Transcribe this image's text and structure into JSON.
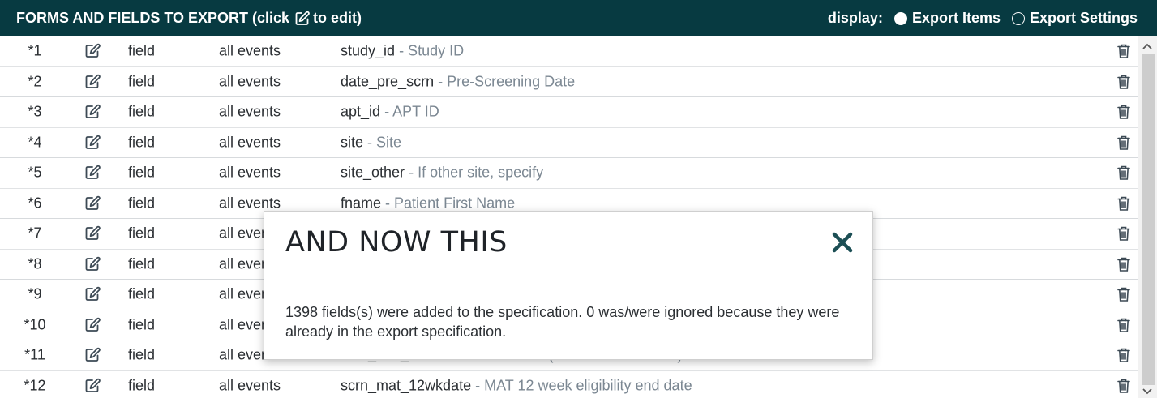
{
  "header": {
    "title_before": "FORMS AND FIELDS TO EXPORT (click",
    "title_after": "to edit)",
    "display_label": "display:",
    "options": [
      {
        "label": "Export Items",
        "selected": true
      },
      {
        "label": "Export Settings",
        "selected": false
      }
    ]
  },
  "rows": [
    {
      "num": "*1",
      "type": "field",
      "events": "all events",
      "name": "study_id",
      "label": "- Study ID"
    },
    {
      "num": "*2",
      "type": "field",
      "events": "all events",
      "name": "date_pre_scrn",
      "label": "- Pre-Screening Date"
    },
    {
      "num": "*3",
      "type": "field",
      "events": "all events",
      "name": "apt_id",
      "label": "- APT ID"
    },
    {
      "num": "*4",
      "type": "field",
      "events": "all events",
      "name": "site",
      "label": "- Site"
    },
    {
      "num": "*5",
      "type": "field",
      "events": "all events",
      "name": "site_other",
      "label": "- If other site, specify"
    },
    {
      "num": "*6",
      "type": "field",
      "events": "all events",
      "name": "fname",
      "label": "- Patient First Name"
    },
    {
      "num": "*7",
      "type": "field",
      "events": "all events",
      "name": "",
      "label": ""
    },
    {
      "num": "*8",
      "type": "field",
      "events": "all events",
      "name": "",
      "label": ""
    },
    {
      "num": "*9",
      "type": "field",
      "events": "all events",
      "name": "",
      "label": ""
    },
    {
      "num": "*10",
      "type": "field",
      "events": "all events",
      "name": "",
      "label": ""
    },
    {
      "num": "*11",
      "type": "field",
      "events": "all events",
      "name": "scrn_mat_start",
      "label": "- MAT start date (less than 24 weeks)"
    },
    {
      "num": "*12",
      "type": "field",
      "events": "all events",
      "name": "scrn_mat_12wkdate",
      "label": "- MAT 12 week eligibility end date"
    }
  ],
  "modal": {
    "title": "AND NOW THIS",
    "body": "1398 fields(s) were added to the specification. 0 was/were ignored because they were already in the export specification."
  },
  "colors": {
    "header_bg": "#073a41",
    "label_gray": "#7b8792",
    "text": "#2b2f33",
    "close_icon": "#1c4f55"
  },
  "icons": {
    "edit": "edit-icon",
    "delete": "trash-icon",
    "close": "close-icon"
  }
}
